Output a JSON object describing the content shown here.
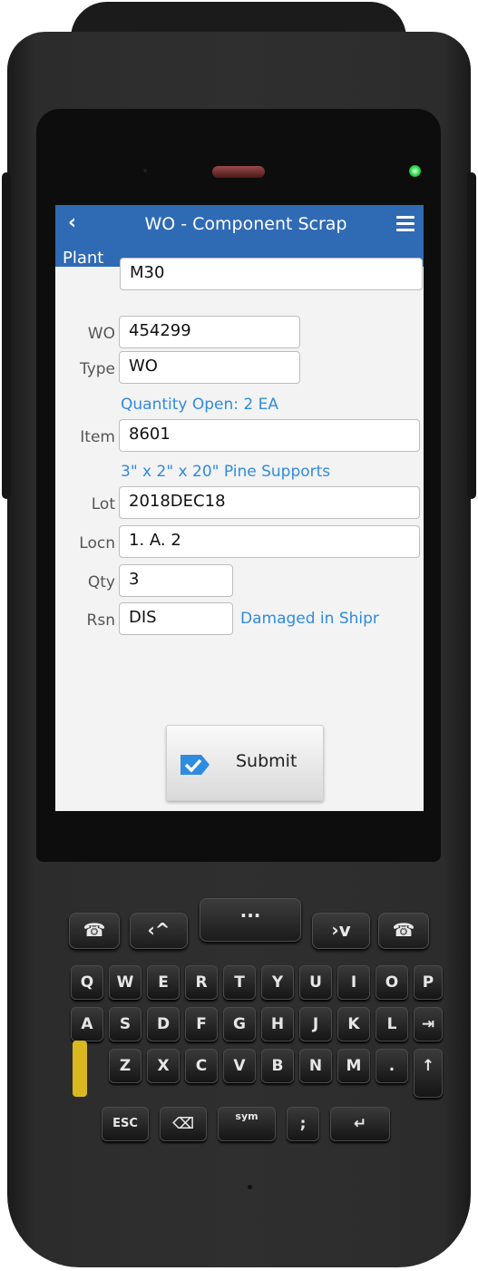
{
  "header": {
    "title": "WO - Component Scrap",
    "back_icon": "chevron-left-icon",
    "menu_icon": "hamburger-menu-icon"
  },
  "plant": {
    "label": "Plant",
    "value": "M30"
  },
  "form": {
    "wo_label": "WO",
    "wo_value": "454299",
    "type_label": "Type",
    "type_value": "WO",
    "quantity_open": "Quantity Open: 2 EA",
    "item_label": "Item",
    "item_value": "8601",
    "item_description": "3\" x 2\" x 20\" Pine Supports",
    "lot_label": "Lot",
    "lot_value": "2018DEC18",
    "locn_label": "Locn",
    "locn_value": "1. A. 2",
    "qty_label": "Qty",
    "qty_value": "3",
    "rsn_label": "Rsn",
    "rsn_value": "DIS",
    "rsn_description": "Damaged in Shipr"
  },
  "submit": {
    "label": "Submit",
    "icon": "checkmark-icon"
  },
  "colors": {
    "header_bg": "#2f6ab4",
    "accent_text": "#2f8be0",
    "screen_bg": "#f3f3f3"
  },
  "keypad": {
    "row1": [
      "Q",
      "W",
      "E",
      "R",
      "T",
      "Y",
      "U",
      "I",
      "O",
      "P"
    ],
    "row2": [
      "A",
      "S",
      "D",
      "F",
      "G",
      "H",
      "J",
      "K",
      "L",
      "⇥"
    ],
    "row3": [
      "Z",
      "X",
      "C",
      "V",
      "B",
      "N",
      "M",
      ".",
      "↑"
    ],
    "esc": "ESC",
    "sym": "sym"
  }
}
